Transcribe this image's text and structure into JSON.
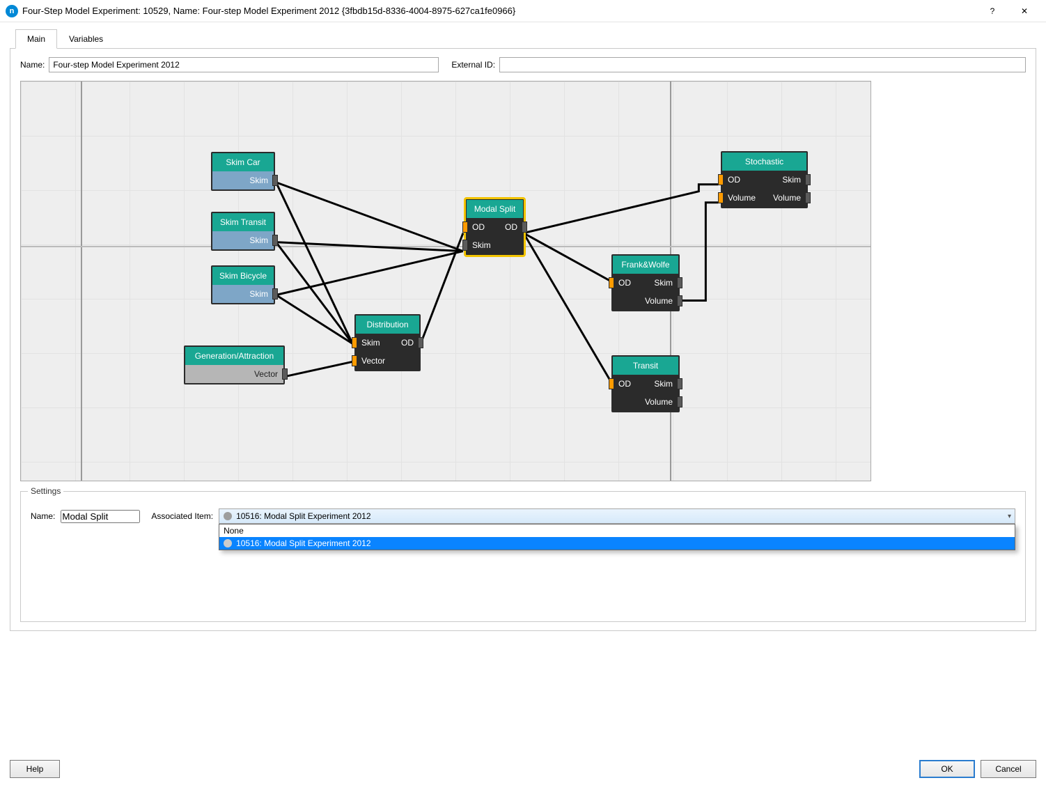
{
  "window": {
    "title": "Four-Step Model Experiment: 10529, Name: Four-step Model Experiment 2012  {3fbdb15d-8336-4004-8975-627ca1fe0966}"
  },
  "tabs": {
    "main": "Main",
    "variables": "Variables"
  },
  "fields": {
    "name_label": "Name:",
    "name_value": "Four-step Model Experiment 2012",
    "external_id_label": "External ID:",
    "external_id_value": ""
  },
  "nodes": {
    "skim_car": {
      "title": "Skim Car",
      "port_out": "Skim"
    },
    "skim_transit": {
      "title": "Skim Transit",
      "port_out": "Skim"
    },
    "skim_bicycle": {
      "title": "Skim Bicycle",
      "port_out": "Skim"
    },
    "gen_attr": {
      "title": "Generation/Attraction",
      "port_out": "Vector"
    },
    "distribution": {
      "title": "Distribution",
      "port_in1": "Skim",
      "port_out1": "OD",
      "port_in2": "Vector"
    },
    "modal_split": {
      "title": "Modal Split",
      "port_in1": "OD",
      "port_out1": "OD",
      "port_in2": "Skim"
    },
    "frank_wolfe": {
      "title": "Frank&Wolfe",
      "port_in": "OD",
      "port_out1": "Skim",
      "port_out2": "Volume"
    },
    "transit": {
      "title": "Transit",
      "port_in": "OD",
      "port_out1": "Skim",
      "port_out2": "Volume"
    },
    "stochastic": {
      "title": "Stochastic",
      "port_in1": "OD",
      "port_out1": "Skim",
      "port_in2": "Volume",
      "port_out2": "Volume"
    }
  },
  "settings": {
    "legend": "Settings",
    "name_label": "Name:",
    "name_value": "Modal Split",
    "assoc_label": "Associated Item:",
    "assoc_selected": "10516: Modal Split Experiment 2012",
    "options": {
      "none": "None",
      "item1": "10516: Modal Split Experiment 2012"
    }
  },
  "buttons": {
    "help": "Help",
    "ok": "OK",
    "cancel": "Cancel"
  }
}
